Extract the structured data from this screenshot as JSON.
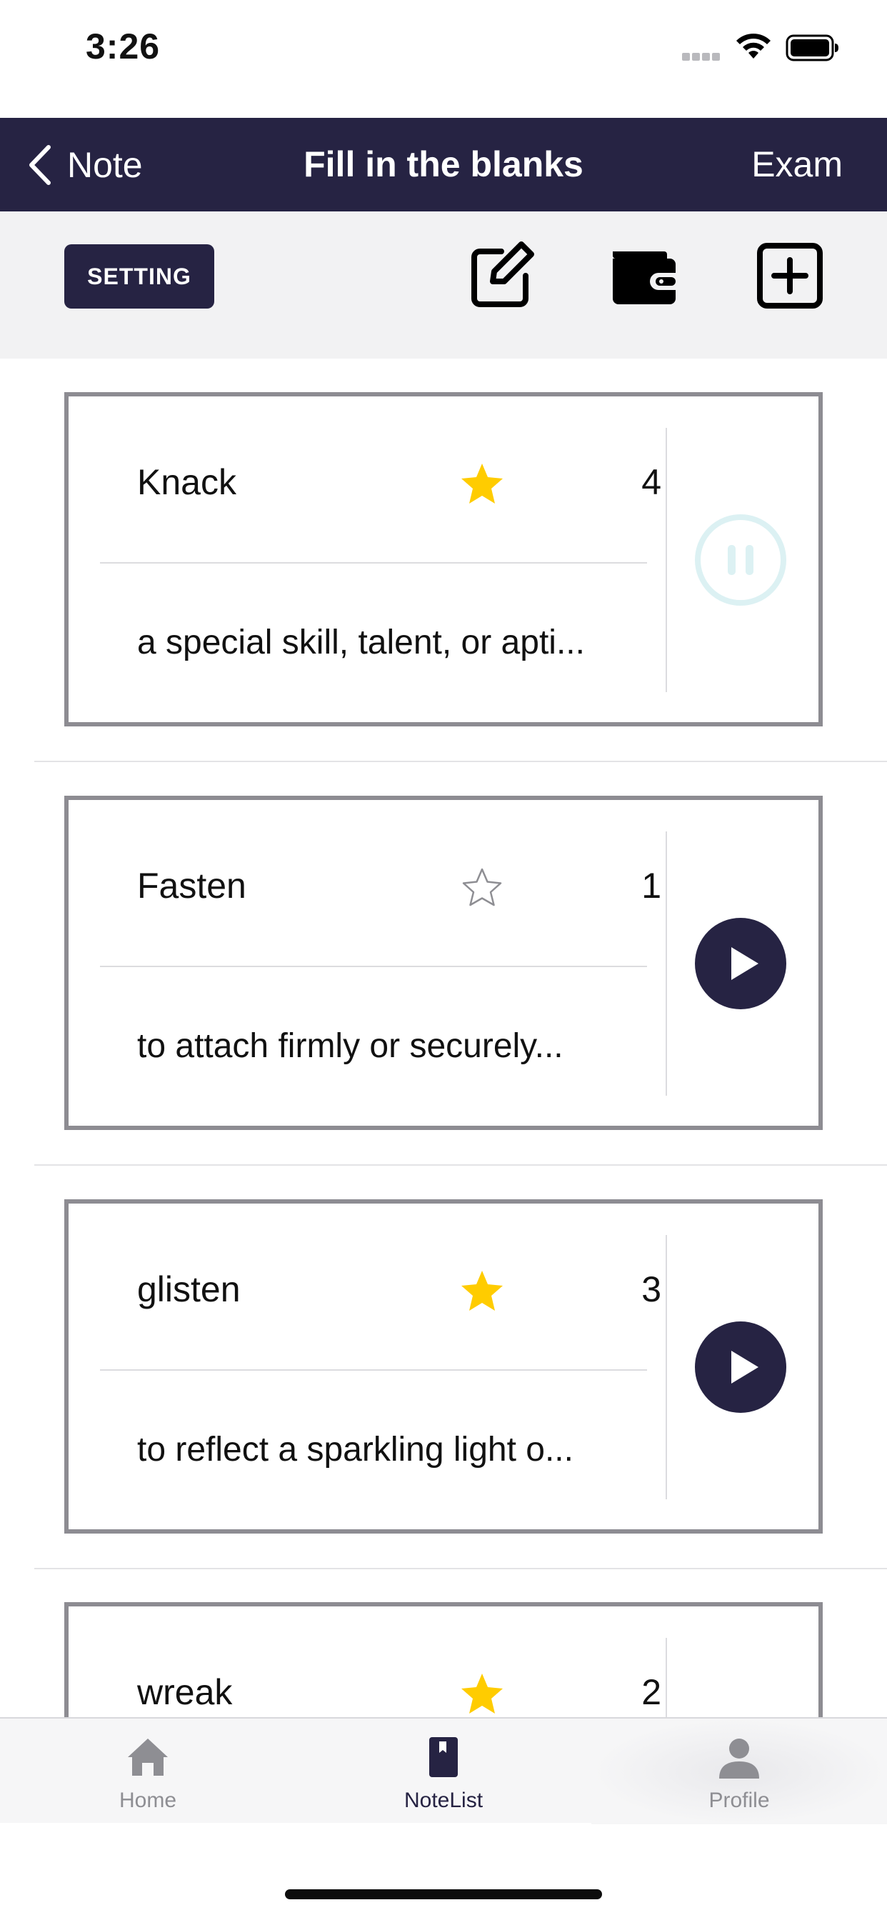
{
  "status_bar": {
    "time": "3:26"
  },
  "nav": {
    "back_label": "Note",
    "title": "Fill in the blanks",
    "right_label": "Exam"
  },
  "toolbar": {
    "setting_label": "SETTING",
    "icons": [
      "edit-icon",
      "wallet-icon",
      "add-square-icon"
    ]
  },
  "notes": [
    {
      "word": "Knack",
      "starred": true,
      "count": "4",
      "meaning": "a special skill, talent, or apti...",
      "play_state": "paused"
    },
    {
      "word": "Fasten",
      "starred": false,
      "count": "1",
      "meaning": "to attach firmly or securely...",
      "play_state": "play"
    },
    {
      "word": "glisten",
      "starred": true,
      "count": "3",
      "meaning": "to reflect a sparkling light o...",
      "play_state": "play"
    },
    {
      "word": "wreak",
      "starred": true,
      "count": "2",
      "meaning": "",
      "play_state": "play"
    }
  ],
  "tab_bar": {
    "items": [
      {
        "label": "Home",
        "icon": "home-icon",
        "active": false
      },
      {
        "label": "NoteList",
        "icon": "book-icon",
        "active": true
      },
      {
        "label": "Profile",
        "icon": "person-icon",
        "active": false
      }
    ]
  },
  "colors": {
    "brand": "#262343",
    "star": "#FFCC00",
    "pause_ring": "#DCF1F3",
    "card_border": "#8D8C92"
  }
}
